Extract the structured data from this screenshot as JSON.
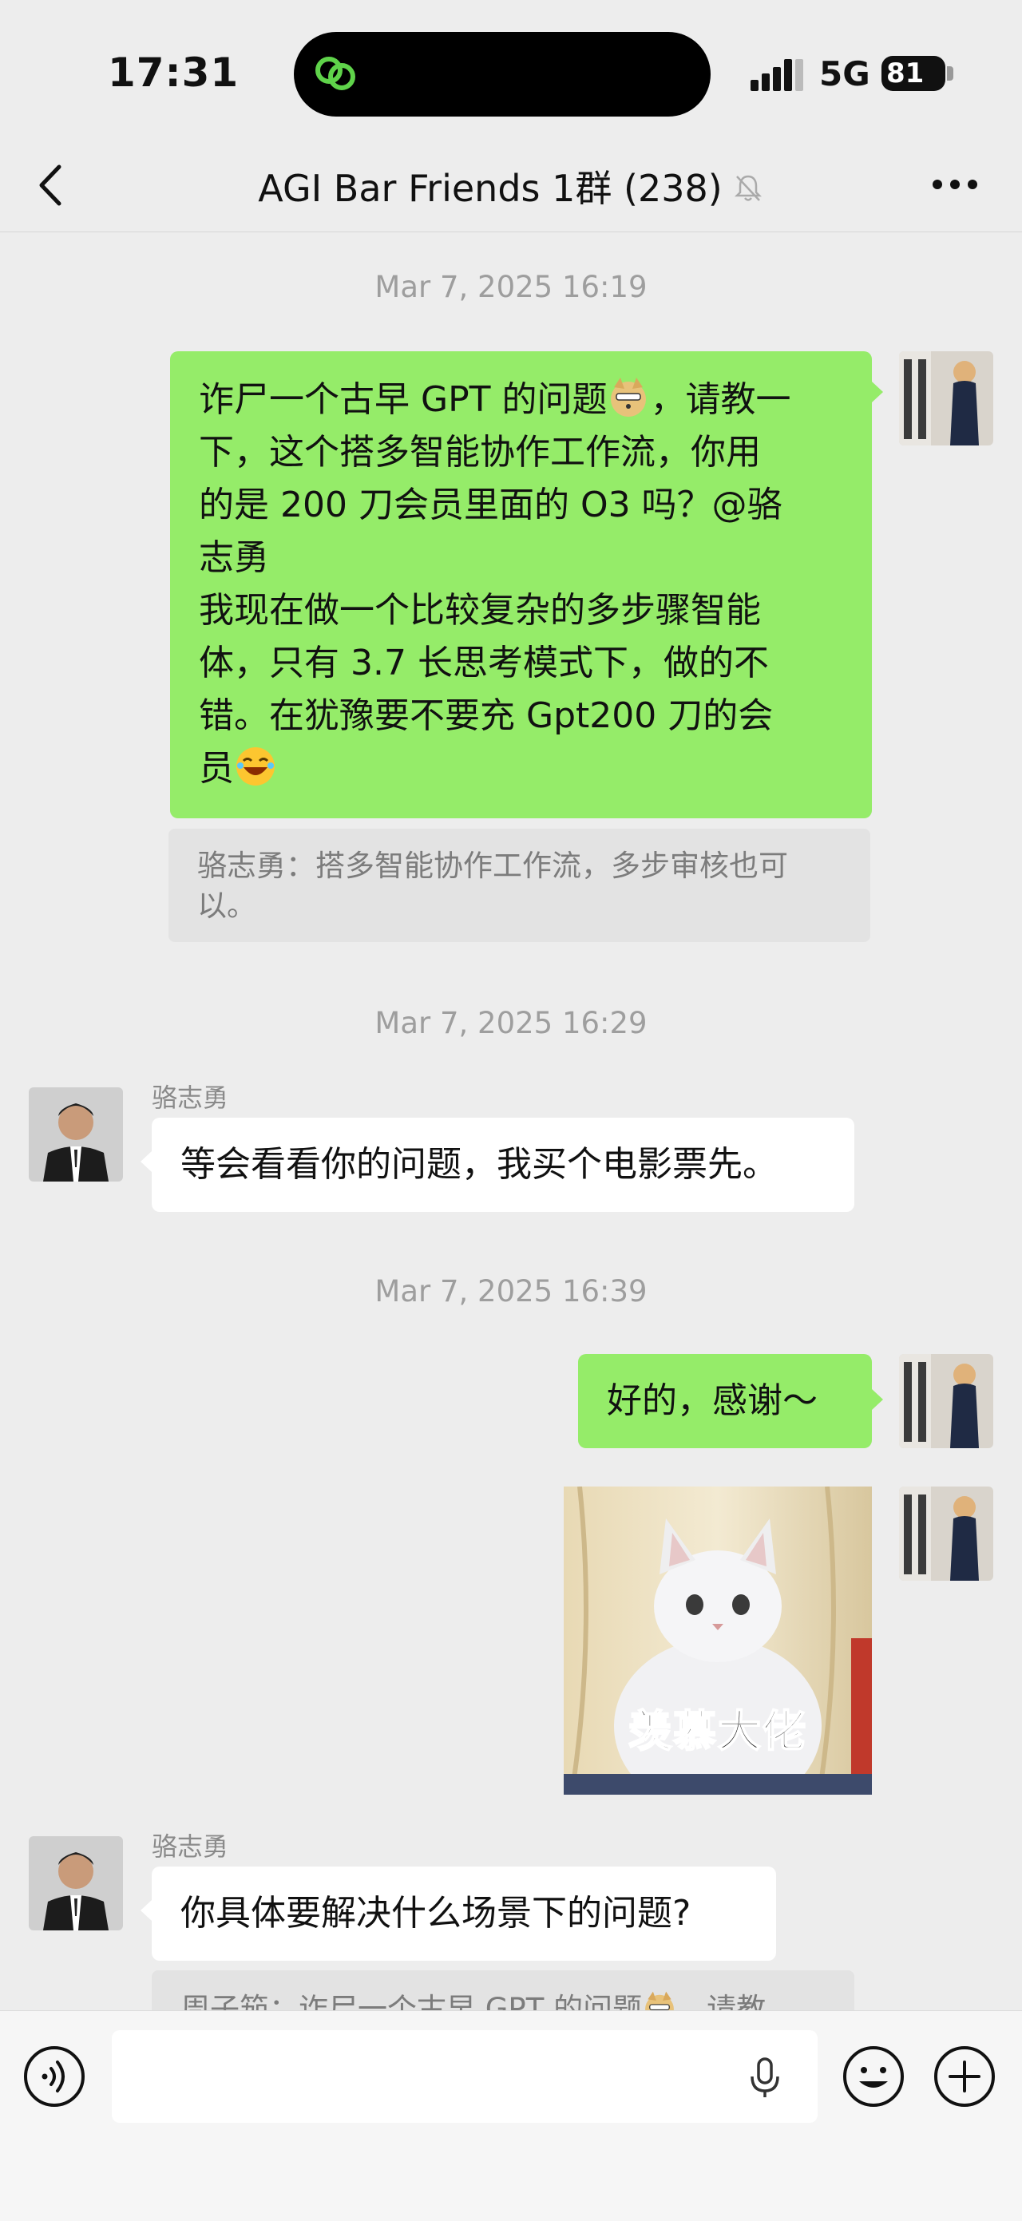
{
  "status_bar": {
    "time": "17:31",
    "network": "5G",
    "battery": "81"
  },
  "nav": {
    "title": "AGI Bar Friends 1群 (238)"
  },
  "icons": {
    "back": "chevron-left-icon",
    "mute": "bell-muted-icon",
    "more": "more-dots-icon",
    "voice": "voice-input-icon",
    "mic": "microphone-icon",
    "emoji": "emoji-face-icon",
    "add": "plus-circle-icon"
  },
  "messages": {
    "ts1": "Mar 7, 2025 16:19",
    "m1": {
      "line1": "诈尸一个古早 GPT 的问题",
      "line1b": "，请教一",
      "line2": "下，这个搭多智能协作工作流，你用",
      "line3": "的是 200 刀会员里面的 O3 吗？@骆",
      "line4": "志勇",
      "line5": "我现在做一个比较复杂的多步骤智能",
      "line6": "体，只有 3.7 长思考模式下，做的不",
      "line7": "错。在犹豫要不要充 Gpt200 刀的会",
      "line8": "员"
    },
    "m1_quote": {
      "line1": "骆志勇：搭多智能协作工作流，多步审核也可",
      "line2": "以。"
    },
    "ts2": "Mar 7, 2025 16:29",
    "m2": {
      "sender": "骆志勇",
      "text": "等会看看你的问题，我买个电影票先。"
    },
    "ts3": "Mar 7, 2025 16:39",
    "m3": {
      "text": "好的，感谢～"
    },
    "m4": {
      "sticker_text": "羡慕大佬"
    },
    "m5": {
      "sender": "骆志勇",
      "text": "你具体要解决什么场景下的问题?"
    },
    "m5_quote": {
      "text": "周子笳：诈尸一个古早 GPT 的问题",
      "text_b": "，请教"
    }
  },
  "colors": {
    "my_bubble": "#95ec69",
    "other_bubble": "#ffffff",
    "background": "#ededed"
  }
}
